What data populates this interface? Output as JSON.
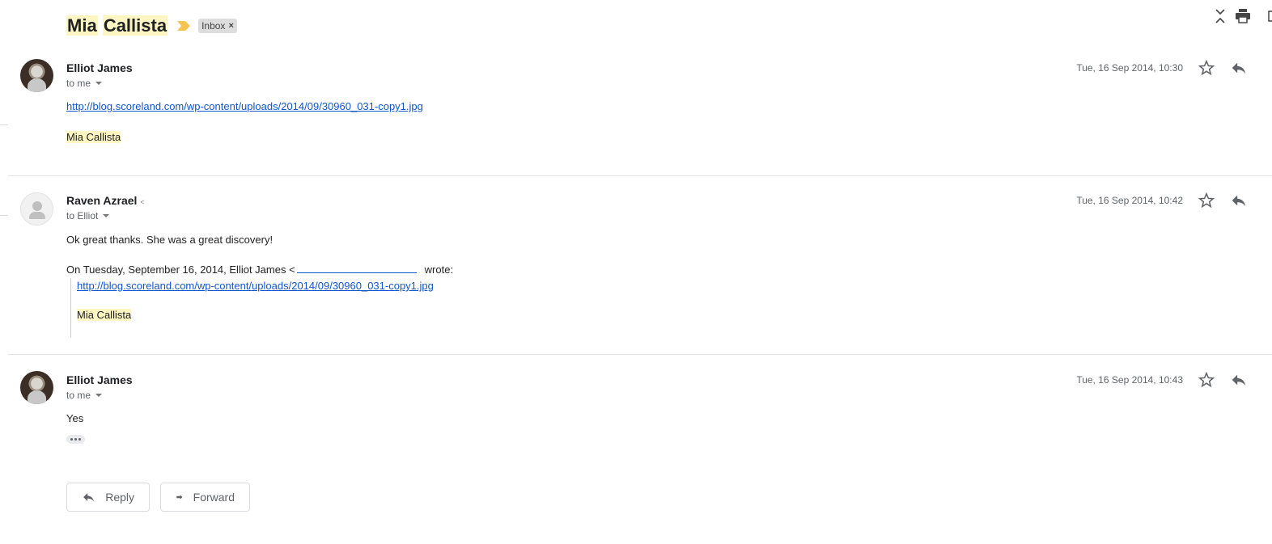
{
  "thread": {
    "subject_word1": "Mia",
    "subject_word2": "Callista",
    "label": "Inbox",
    "label_remove": "×",
    "highlight_color": "#fdf6c3",
    "importance_color": "#f6c453"
  },
  "messages": [
    {
      "sender": "Elliot James",
      "recipient": "to me",
      "date": "Tue, 16 Sep 2014, 10:30",
      "link": "http://blog.scoreland.com/wp-content/uploads/2014/09/30960_031-copy1.jpg",
      "signature": "Mia Callista"
    },
    {
      "sender": "Raven Azrael",
      "sender_suffix": "<",
      "recipient": "to Elliot",
      "date": "Tue, 16 Sep 2014, 10:42",
      "text": "Ok great thanks. She was a great discovery!",
      "quote_header_pre": "On Tuesday, September 16, 2014, Elliot James <",
      "quote_header_post": "wrote:",
      "quote_link": "http://blog.scoreland.com/wp-content/uploads/2014/09/30960_031-copy1.jpg",
      "quote_signature": "Mia Callista"
    },
    {
      "sender": "Elliot James",
      "recipient": "to me",
      "date": "Tue, 16 Sep 2014, 10:43",
      "text": "Yes"
    }
  ],
  "actions": {
    "reply_label": "Reply",
    "forward_label": "Forward"
  },
  "icons": {
    "collapse": "collapse-all-icon",
    "print": "print-icon",
    "new_window": "new-window-icon",
    "star": "star-icon",
    "reply": "reply-icon",
    "forward": "forward-icon"
  }
}
